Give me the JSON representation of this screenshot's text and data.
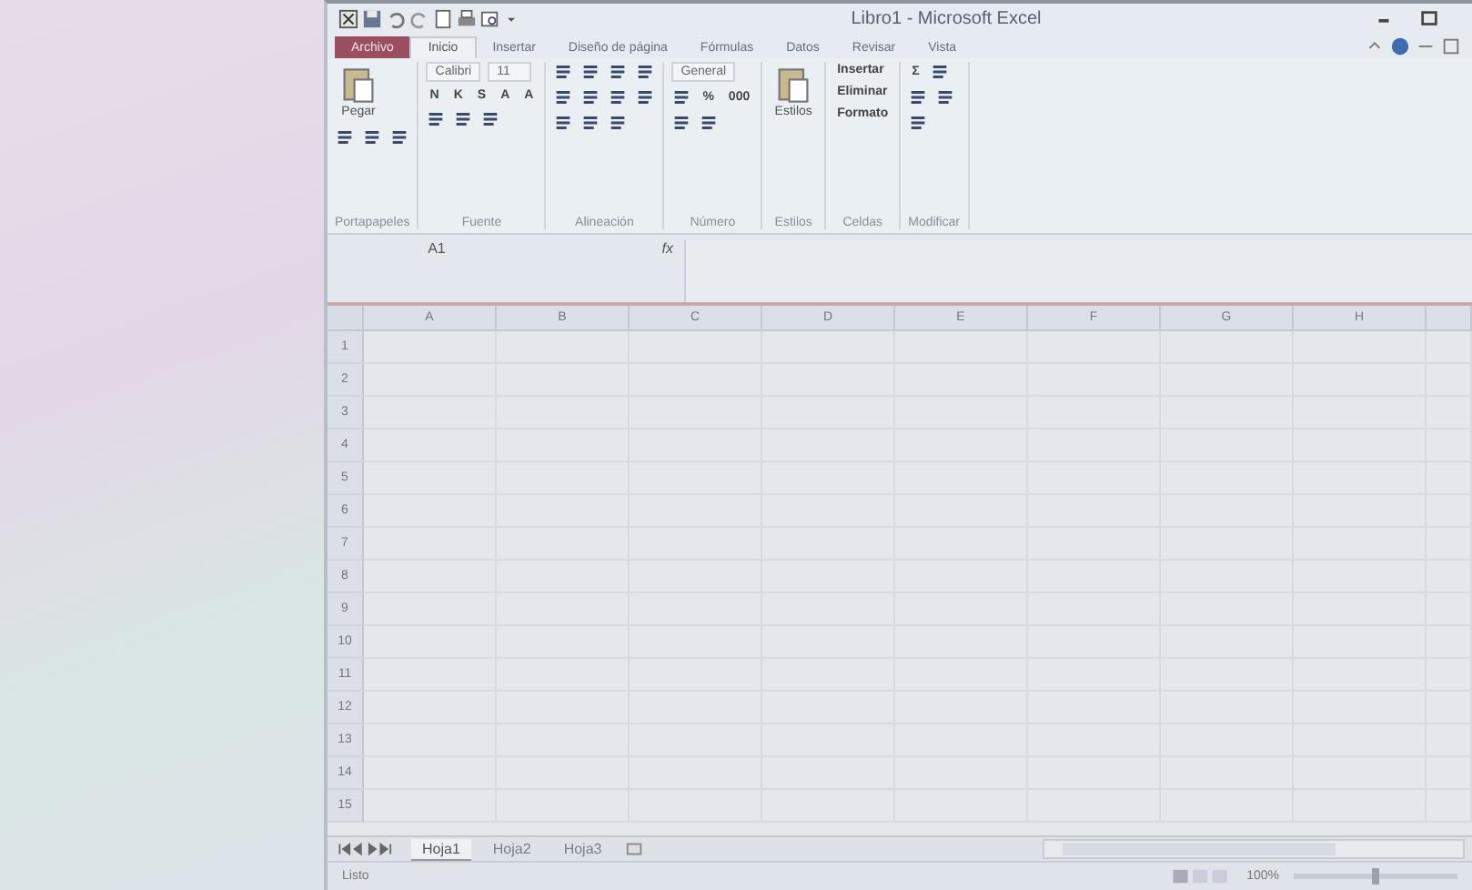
{
  "window": {
    "title": "Libro1 - Microsoft Excel"
  },
  "tabs": [
    {
      "label": "Archivo",
      "kind": "file",
      "selected": false
    },
    {
      "label": "Inicio",
      "kind": "tab",
      "selected": true
    },
    {
      "label": "Insertar",
      "kind": "tab",
      "selected": false
    },
    {
      "label": "Diseño de página",
      "kind": "tab",
      "selected": false
    },
    {
      "label": "Fórmulas",
      "kind": "tab",
      "selected": false
    },
    {
      "label": "Datos",
      "kind": "tab",
      "selected": false
    },
    {
      "label": "Revisar",
      "kind": "tab",
      "selected": false
    },
    {
      "label": "Vista",
      "kind": "tab",
      "selected": false
    }
  ],
  "ribbon": [
    {
      "label": "Portapapeles",
      "stacks": [
        [
          {
            "kind": "big",
            "label": "Pegar"
          }
        ],
        [
          {
            "kind": "icon"
          },
          {
            "kind": "icon"
          },
          {
            "kind": "icon"
          }
        ]
      ]
    },
    {
      "label": "Fuente",
      "stacks": [
        [
          {
            "kind": "field",
            "label": "Calibri"
          },
          {
            "kind": "field",
            "label": "11"
          }
        ],
        [
          {
            "kind": "button",
            "label": "N"
          },
          {
            "kind": "button",
            "label": "K"
          },
          {
            "kind": "button",
            "label": "S"
          },
          {
            "kind": "button",
            "label": "A"
          },
          {
            "kind": "button",
            "label": "A"
          }
        ],
        [
          {
            "kind": "icon"
          },
          {
            "kind": "icon"
          },
          {
            "kind": "icon"
          }
        ]
      ]
    },
    {
      "label": "Alineación",
      "stacks": [
        [
          {
            "kind": "icon"
          },
          {
            "kind": "icon"
          },
          {
            "kind": "icon"
          },
          {
            "kind": "icon"
          }
        ],
        [
          {
            "kind": "icon"
          },
          {
            "kind": "icon"
          },
          {
            "kind": "icon"
          },
          {
            "kind": "icon"
          }
        ],
        [
          {
            "kind": "icon"
          },
          {
            "kind": "icon"
          },
          {
            "kind": "icon"
          }
        ]
      ]
    },
    {
      "label": "Número",
      "stacks": [
        [
          {
            "kind": "field",
            "label": "General"
          }
        ],
        [
          {
            "kind": "icon"
          },
          {
            "kind": "button",
            "label": "%"
          },
          {
            "kind": "button",
            "label": "000"
          }
        ],
        [
          {
            "kind": "icon"
          },
          {
            "kind": "icon"
          }
        ]
      ]
    },
    {
      "label": "Estilos",
      "stacks": [
        [
          {
            "kind": "big",
            "label": "Estilos"
          }
        ]
      ]
    },
    {
      "label": "Celdas",
      "stacks": [
        [
          {
            "kind": "button",
            "label": "Insertar"
          }
        ],
        [
          {
            "kind": "button",
            "label": "Eliminar"
          }
        ],
        [
          {
            "kind": "button",
            "label": "Formato"
          }
        ]
      ]
    },
    {
      "label": "Modificar",
      "stacks": [
        [
          {
            "kind": "button",
            "label": "Σ"
          },
          {
            "kind": "icon"
          }
        ],
        [
          {
            "kind": "icon"
          },
          {
            "kind": "icon"
          }
        ],
        [
          {
            "kind": "icon"
          }
        ]
      ]
    }
  ],
  "formula_bar": {
    "name_box": "A1",
    "function_label": "fx"
  },
  "columns": [
    "A",
    "B",
    "C",
    "D",
    "E",
    "F",
    "G",
    "H"
  ],
  "rows": [
    "1",
    "2",
    "3",
    "4",
    "5",
    "6",
    "7",
    "8",
    "9",
    "10",
    "11",
    "12",
    "13",
    "14",
    "15"
  ],
  "sheets": [
    {
      "label": "Hoja1",
      "selected": true
    },
    {
      "label": "Hoja2",
      "selected": false
    },
    {
      "label": "Hoja3",
      "selected": false
    }
  ],
  "status_bar": {
    "status": "Listo",
    "zoom": "100%",
    "level": 0.5
  }
}
